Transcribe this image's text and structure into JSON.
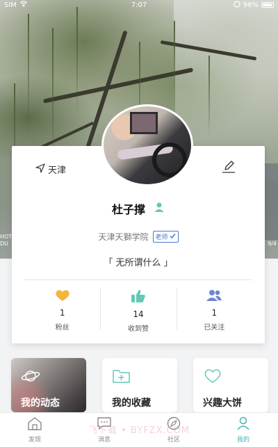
{
  "status_bar": {
    "carrier": "SIM",
    "time": "7:07",
    "battery": "96%"
  },
  "hero": {
    "left_text": "HOT\nDU",
    "right_text": "9/4"
  },
  "profile": {
    "location": "天津",
    "name": "杜子撑",
    "school": "天津天獅学院",
    "role_badge": "老师",
    "motto": "「 无所谓什么 」"
  },
  "stats": [
    {
      "icon": "heart-icon",
      "count": "1",
      "label": "粉丝",
      "color": "#f3b63c"
    },
    {
      "icon": "thumbs-up-icon",
      "count": "14",
      "label": "收到赞",
      "color": "#63c9b8"
    },
    {
      "icon": "users-icon",
      "count": "1",
      "label": "已关注",
      "color": "#6f86d6"
    }
  ],
  "tiles": [
    {
      "label": "我的动态",
      "icon": "planet-icon"
    },
    {
      "label": "我的收藏",
      "icon": "folder-plus-icon"
    },
    {
      "label": "兴趣大饼",
      "icon": "heart-outline-icon"
    }
  ],
  "tabs": [
    {
      "label": "发现",
      "icon": "home-icon",
      "active": false
    },
    {
      "label": "消息",
      "icon": "message-icon",
      "active": false
    },
    {
      "label": "社区",
      "icon": "compass-icon",
      "active": false
    },
    {
      "label": "我的",
      "icon": "user-icon",
      "active": true
    }
  ],
  "watermark": "飞下载 • BYFZX.COM",
  "colors": {
    "accent": "#3fb5b0",
    "badge_blue": "#4a78c8"
  }
}
